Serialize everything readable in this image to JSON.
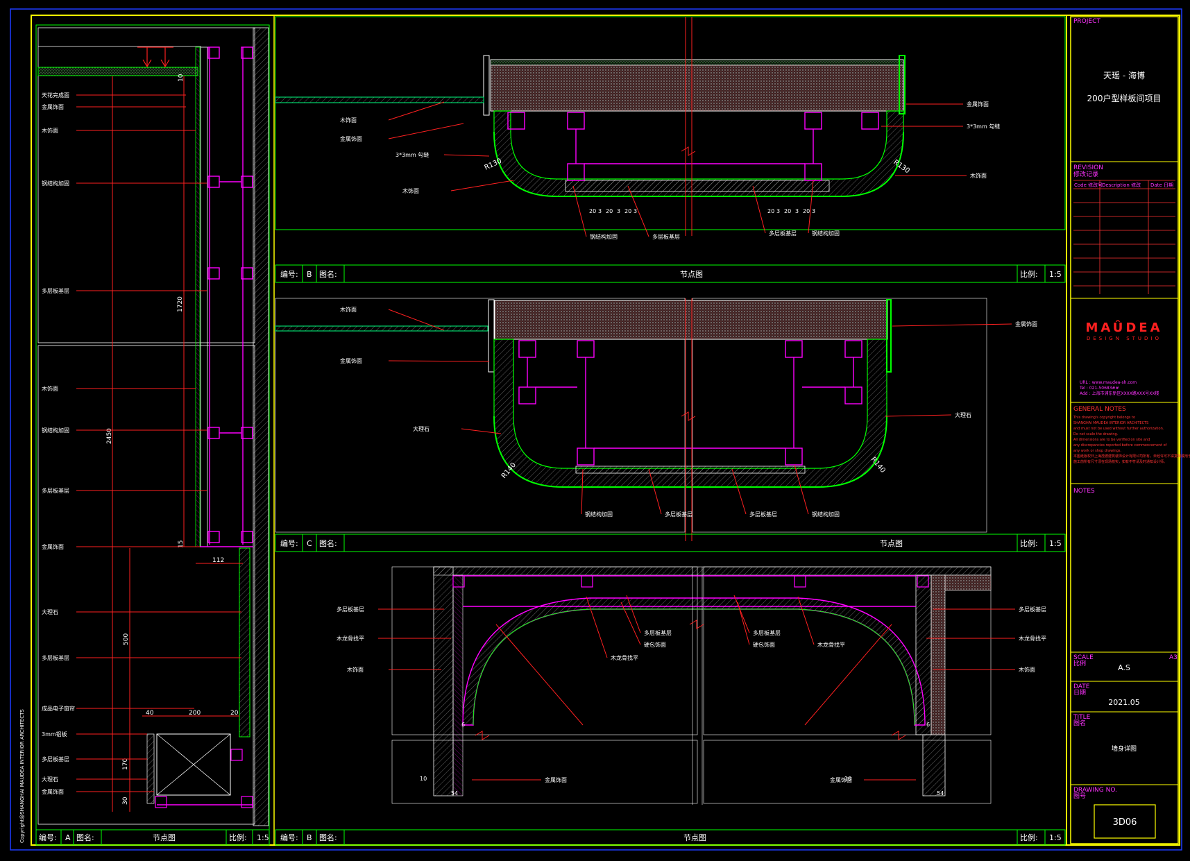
{
  "colors": {
    "frame": "#ffff00",
    "border": "#00ff00",
    "structure": "#ff00ff",
    "leader": "#ff2020",
    "finish": "#00ff7f",
    "text": "#ffffff",
    "highlight": "#ff2060",
    "blue_outer": "#1e3cff"
  },
  "copyright": "Copyright@SHANGHAI MAUDEA INTERIOR ARCHITECTS",
  "title_block": {
    "project_label": "PROJECT",
    "project_line1": "天瑶 - 海博",
    "project_line2": "200户型样板间项目",
    "revision_label": "REVISION",
    "revision_sub": "修改记录",
    "rev_headers": [
      "Code 修改号",
      "Description 修改",
      "Date 日期"
    ],
    "logo": "MAÛDEA",
    "logo_sub": "DESIGN STUDIO",
    "url": "URL : www.maudea-sh.com",
    "tel": "Tel : 021-50683##",
    "addr": "Add : 上海市浦东新区XXXX路XXX号XX楼",
    "general_notes_label": "GENERAL NOTES",
    "general_notes": [
      "This drawing's copyright belongs to",
      "SHANGHAI MAUDEA INTERIOR ARCHITECTS",
      "and must not be used without further authorization.",
      "Do not scale the drawing.",
      "All dimensions are to be verified on site and",
      "any discrepancies reported before commencement of",
      "any work or shop drawings.",
      "本图纸版权归上海茂德建筑装饰设计有限公司所有，未经许可不得复制或用于其它工程项目。",
      "施工前所有尺寸须在现场核实，如有不符请及时通知设计师。"
    ],
    "notes_label": "NOTES",
    "scale_label": "SCALE",
    "scale_sub": "比例",
    "scale_paper": "A3",
    "scale_value": "A.S",
    "date_label": "DATE",
    "date_sub": "日期",
    "date_value": "2021.05",
    "title_label": "TITLE",
    "title_sub": "图名",
    "title_value": "墙身详图",
    "drawing_no_label": "DRAWING NO.",
    "drawing_no_sub": "图号",
    "drawing_no": "3D06"
  },
  "strips": {
    "code_label": "编号:",
    "name_label": "图名:",
    "scale_label": "比例:",
    "name": "节点图",
    "scale": "1:5",
    "A": "A",
    "B_top": "B",
    "C": "C",
    "B_bottom": "B"
  },
  "panel_a": {
    "labels": [
      "天花完成面",
      "金属饰面",
      "木饰面",
      "钢结构加固",
      "多层板基层",
      "木饰面",
      "钢结构加固",
      "多层板基层",
      "金属饰面",
      "大理石",
      "多层板基层",
      "成品电子窗帘",
      "3mm铝板",
      "多层板基层",
      "大理石",
      "金属饰面"
    ],
    "dims": [
      "1720",
      "2450",
      "500",
      "112",
      "200",
      "40",
      "20",
      "170",
      "30",
      "10",
      "15"
    ]
  },
  "panel_b": {
    "labels_left": [
      "木饰面",
      "金属饰面",
      "3*3mm 勾缝",
      "木饰面"
    ],
    "labels_right": [
      "金属饰面",
      "3*3mm 勾缝",
      "木饰面"
    ],
    "labels_bottom": [
      "钢结构加固",
      "多层板基层",
      "多层板基层",
      "钢结构加固"
    ],
    "radius_left": "R130",
    "radius_right": "R130",
    "dims": [
      "20",
      "3",
      "20",
      "3",
      "20",
      "3"
    ]
  },
  "panel_c": {
    "labels_left": [
      "木饰面",
      "金属饰面",
      "大理石"
    ],
    "labels_right": [
      "金属饰面",
      "大理石"
    ],
    "labels_bottom": [
      "钢结构加固",
      "多层板基层",
      "多层板基层",
      "钢结构加固"
    ],
    "radius_left": "R140",
    "radius_right": "R140"
  },
  "panel_b2": {
    "labels_left": [
      "多层板基层",
      "木龙骨找平",
      "木饰面"
    ],
    "labels_right": [
      "多层板基层",
      "木龙骨找平",
      "木饰面"
    ],
    "labels_mid": [
      "多层板基层",
      "硬包饰面",
      "木龙骨找平",
      "多层板基层",
      "硬包饰面",
      "木龙骨找平"
    ],
    "labels_bottom": [
      "金属饰面",
      "金属饰面"
    ],
    "dims": [
      "54",
      "54",
      "10",
      "10",
      "6",
      "6"
    ]
  }
}
